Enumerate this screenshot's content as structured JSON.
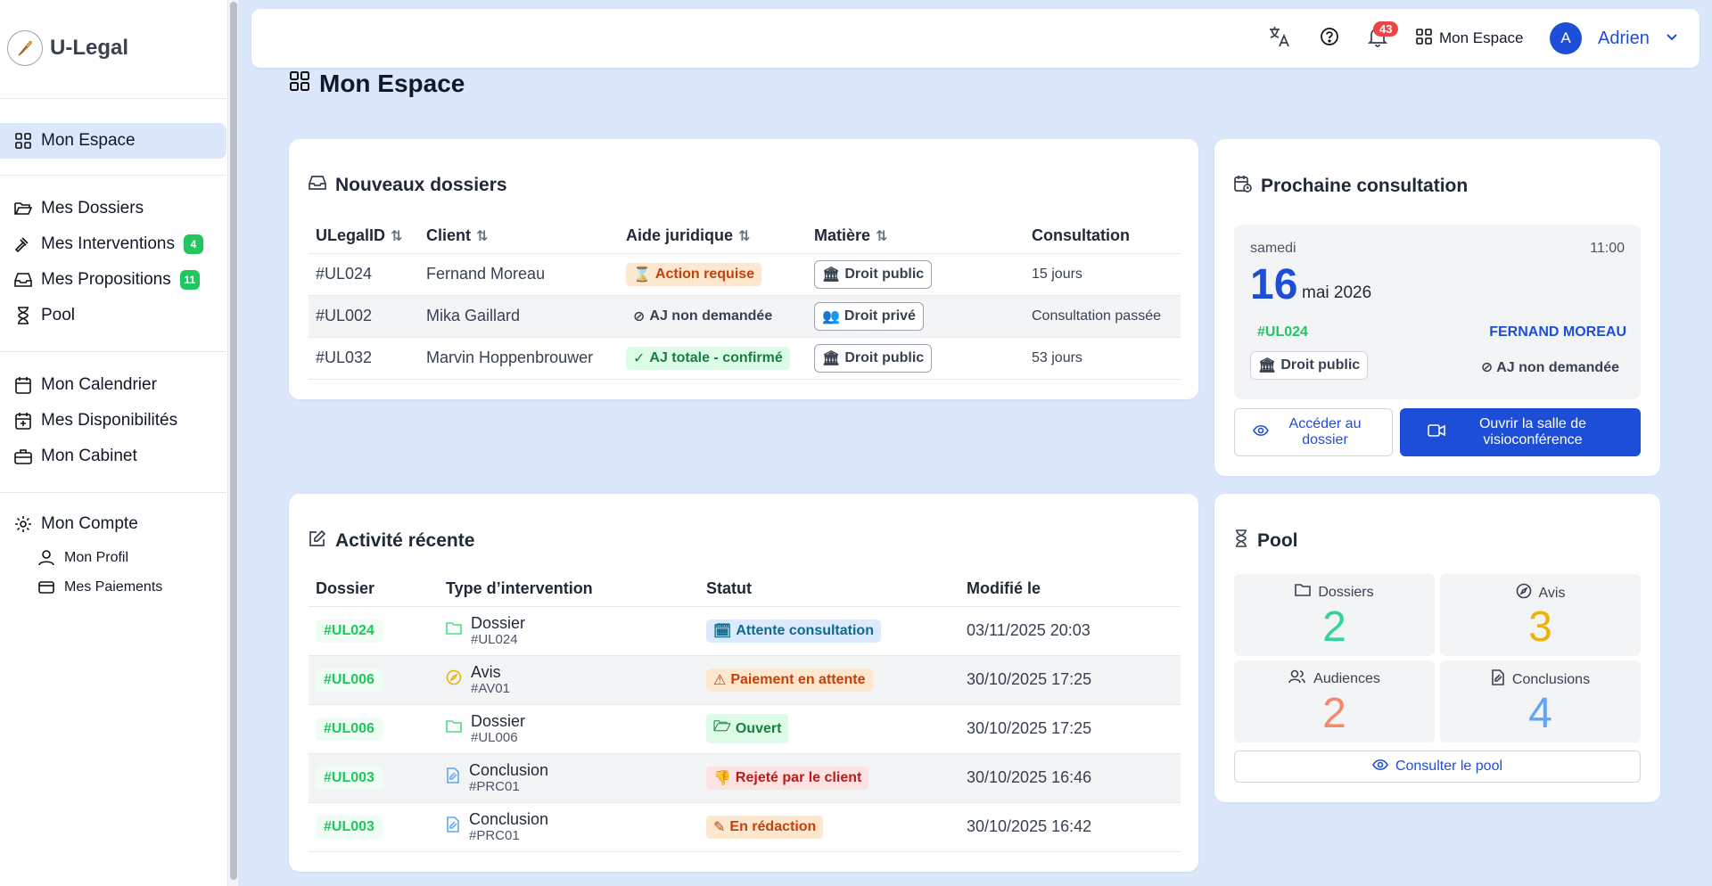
{
  "app": {
    "name": "U-Legal"
  },
  "sidebar": {
    "items": [
      {
        "label": "Mon Espace"
      },
      {
        "label": "Mes Dossiers"
      },
      {
        "label": "Mes Interventions",
        "badge": "4"
      },
      {
        "label": "Mes Propositions",
        "badge": "11"
      },
      {
        "label": "Pool"
      },
      {
        "label": "Mon Calendrier"
      },
      {
        "label": "Mes Disponibilités"
      },
      {
        "label": "Mon Cabinet"
      },
      {
        "label": "Mon Compte"
      }
    ],
    "subitems": [
      {
        "label": "Mon Profil"
      },
      {
        "label": "Mes Paiements"
      }
    ]
  },
  "topbar": {
    "notif_count": "43",
    "space_label": "Mon Espace",
    "avatar_initial": "A",
    "user_name": "Adrien"
  },
  "page": {
    "title": "Mon Espace"
  },
  "new_files": {
    "title": "Nouveaux dossiers",
    "columns": [
      "ULegalID",
      "Client",
      "Aide juridique",
      "Matière",
      "Consultation"
    ],
    "rows": [
      {
        "id": "#UL024",
        "client": "Fernand Moreau",
        "aid": "Action requise",
        "subject": "Droit public",
        "consultation": "15 jours"
      },
      {
        "id": "#UL002",
        "client": "Mika Gaillard",
        "aid": "AJ non demandée",
        "subject": "Droit privé",
        "consultation": "Consultation passée"
      },
      {
        "id": "#UL032",
        "client": "Marvin Hoppenbrouwer",
        "aid": "AJ totale - confirmé",
        "subject": "Droit public",
        "consultation": "53 jours"
      }
    ]
  },
  "next_consultation": {
    "title": "Prochaine consultation",
    "weekday": "samedi",
    "time": "11:00",
    "day": "16",
    "month_year": "mai 2026",
    "file_id": "#UL024",
    "client": "FERNAND MOREAU",
    "subject": "Droit public",
    "aid": "AJ non demandée",
    "open_file_label": "Accéder au dossier",
    "visio_label": "Ouvrir la salle de visioconférence"
  },
  "activity": {
    "title": "Activité récente",
    "columns": [
      "Dossier",
      "Type d’intervention",
      "Statut",
      "Modifié le"
    ],
    "rows": [
      {
        "file": "#UL024",
        "type": "Dossier",
        "ref": "#UL024",
        "status": "Attente consultation",
        "date": "03/11/2025 20:03"
      },
      {
        "file": "#UL006",
        "type": "Avis",
        "ref": "#AV01",
        "status": "Paiement en attente",
        "date": "30/10/2025 17:25"
      },
      {
        "file": "#UL006",
        "type": "Dossier",
        "ref": "#UL006",
        "status": "Ouvert",
        "date": "30/10/2025 17:25"
      },
      {
        "file": "#UL003",
        "type": "Conclusion",
        "ref": "#PRC01",
        "status": "Rejeté par le client",
        "date": "30/10/2025 16:46"
      },
      {
        "file": "#UL003",
        "type": "Conclusion",
        "ref": "#PRC01",
        "status": "En rédaction",
        "date": "30/10/2025 16:42"
      }
    ]
  },
  "pool": {
    "title": "Pool",
    "stats": [
      {
        "label": "Dossiers",
        "value": "2",
        "color": "#34d399"
      },
      {
        "label": "Avis",
        "value": "3",
        "color": "#eab308"
      },
      {
        "label": "Audiences",
        "value": "2",
        "color": "#f38a6b"
      },
      {
        "label": "Conclusions",
        "value": "4",
        "color": "#60a5fa"
      }
    ],
    "button_label": "Consulter le pool"
  }
}
